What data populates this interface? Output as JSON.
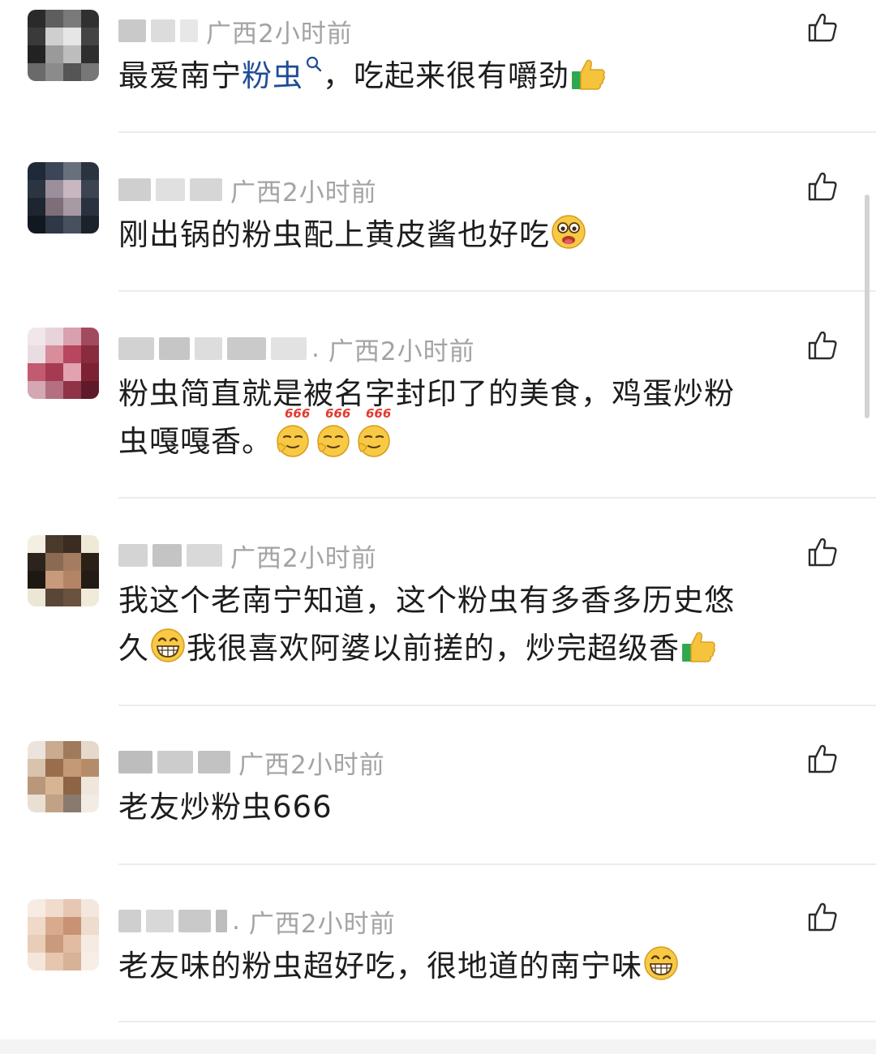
{
  "comments": [
    {
      "region": "广西",
      "time": "2小时前",
      "text_parts": [
        "最爱南宁",
        "粉虫",
        "，吃起来很有嚼劲"
      ],
      "emoji": [
        "thumbs-up-icon"
      ]
    },
    {
      "region": "广西",
      "time": "2小时前",
      "text": "刚出锅的粉虫配上黄皮酱也好吃",
      "emoji": [
        "drooling-face-icon"
      ]
    },
    {
      "region": "广西",
      "time": "2小时前",
      "name_suffix": ".",
      "text_line1": "粉虫简直就是被名字封印了的美食，鸡蛋炒粉",
      "text_line2": "虫嘎嘎香。",
      "emoji_badge": "666",
      "emoji": [
        "666-face-icon",
        "666-face-icon",
        "666-face-icon"
      ]
    },
    {
      "region": "广西",
      "time": "2小时前",
      "text_line1": "我这个老南宁知道，这个粉虫有多香多历史悠",
      "text_line2_a": "久",
      "text_line2_b": "我很喜欢阿婆以前搓的，炒完超级香",
      "emoji": [
        "grinning-face-icon",
        "thumbs-up-icon"
      ]
    },
    {
      "region": "广西",
      "time": "2小时前",
      "text": "老友炒粉虫666"
    },
    {
      "region": "广西",
      "time": "2小时前",
      "name_suffix": ".",
      "text": "老友味的粉虫超好吃，很地道的南宁味",
      "emoji": [
        "grinning-face-icon"
      ]
    }
  ],
  "colors": {
    "link": "#1f4d97",
    "meta": "#a3a3a3",
    "divider": "#ececec"
  }
}
